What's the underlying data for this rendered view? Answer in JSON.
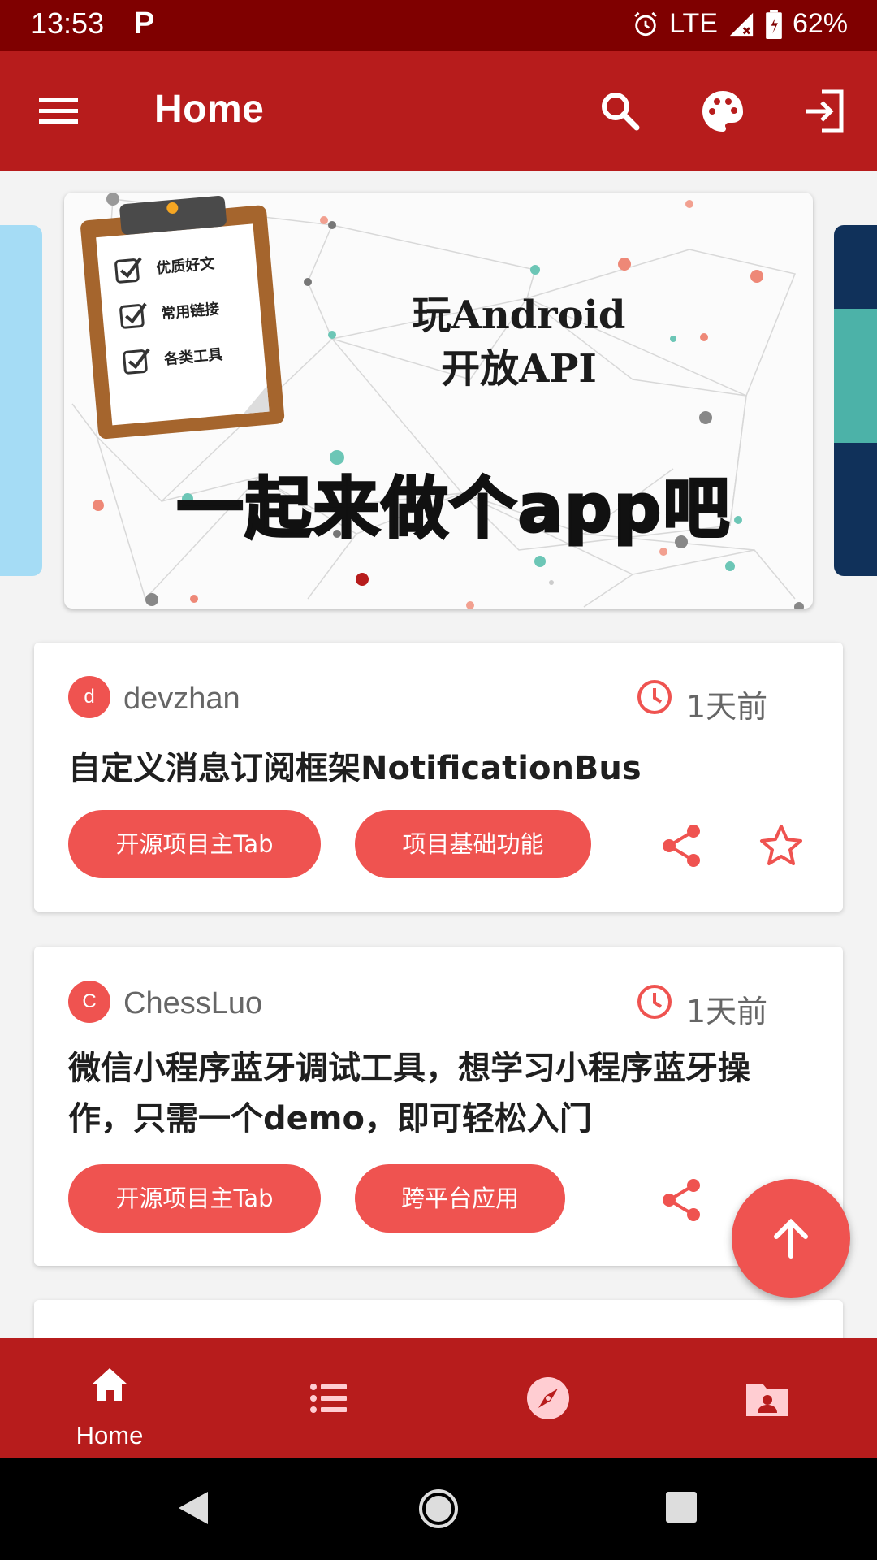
{
  "status_bar": {
    "time": "13:53",
    "carrier_icon": "P",
    "network": "LTE",
    "battery": "62%"
  },
  "app_bar": {
    "title": "Home",
    "icons": [
      "menu-icon",
      "search-icon",
      "palette-icon",
      "logout-icon"
    ]
  },
  "banner": {
    "checklist": [
      "优质好文",
      "常用链接",
      "各类工具"
    ],
    "heading_line1": "玩Android",
    "heading_line2": "开放API",
    "slogan": "一起来做个app吧",
    "page_indicator": "1"
  },
  "articles": [
    {
      "avatar_letter": "d",
      "author": "devzhan",
      "time": "1天前",
      "title": "自定义消息订阅框架NotificationBus",
      "tags": [
        "开源项目主Tab",
        "项目基础功能"
      ]
    },
    {
      "avatar_letter": "C",
      "author": "ChessLuo",
      "time": "1天前",
      "title_line1": "微信小程序蓝牙调试工具，想学习小程序蓝牙操",
      "title_line2": "作，只需一个demo，即可轻松入门",
      "tags": [
        "开源项目主Tab",
        "跨平台应用"
      ]
    }
  ],
  "bottom_nav": {
    "active": "Home",
    "items": [
      {
        "label": "Home",
        "icon": "home-icon"
      },
      {
        "label": "",
        "icon": "list-icon"
      },
      {
        "label": "",
        "icon": "compass-icon"
      },
      {
        "label": "",
        "icon": "contact-folder-icon"
      }
    ]
  },
  "colors": {
    "primary": "#b71c1c",
    "primary_dark": "#7f0000",
    "accent": "#ef5350",
    "background": "#f3f3f3"
  }
}
